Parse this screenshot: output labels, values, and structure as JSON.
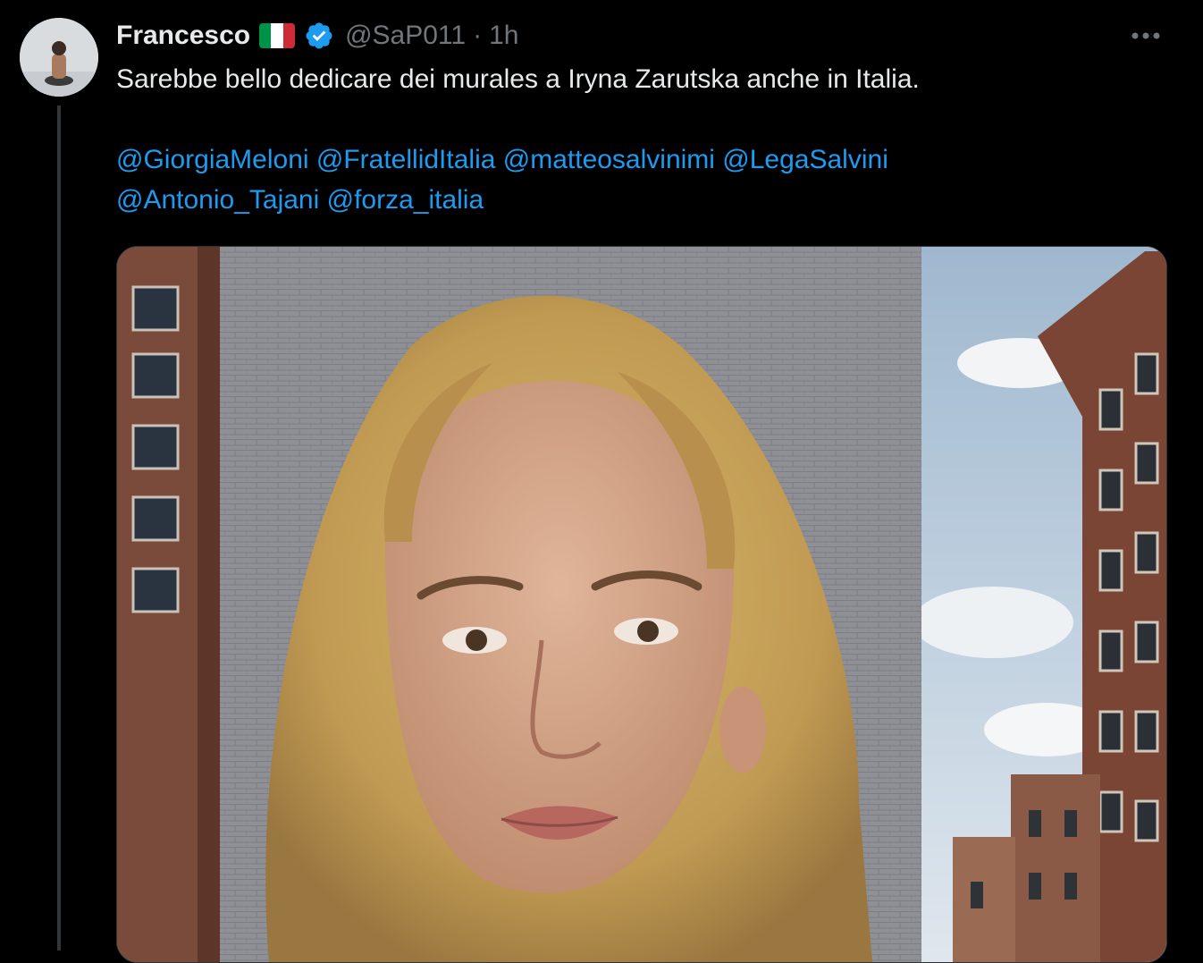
{
  "author": {
    "display_name": "Francesco",
    "handle": "@SaP011",
    "timestamp": "1h",
    "separator": "·",
    "flag_icon": "italy-flag-icon",
    "verified_icon": "verified-badge-icon"
  },
  "tweet": {
    "text": "Sarebbe bello dedicare dei murales a Iryna Zarutska anche in Italia.",
    "mentions": [
      "@GiorgiaMeloni",
      "@FratellidItalia",
      "@matteosalvinimi",
      "@LegaSalvini",
      "@Antonio_Tajani",
      "@forza_italia"
    ]
  },
  "media": {
    "type": "photo",
    "subject": "mural-portrait-on-brick-building"
  },
  "colors": {
    "background": "#000000",
    "text": "#e7e9ea",
    "secondary_text": "#71767b",
    "link": "#1d9bf0",
    "verified": "#1d9bf0",
    "thread_line": "#333639"
  }
}
